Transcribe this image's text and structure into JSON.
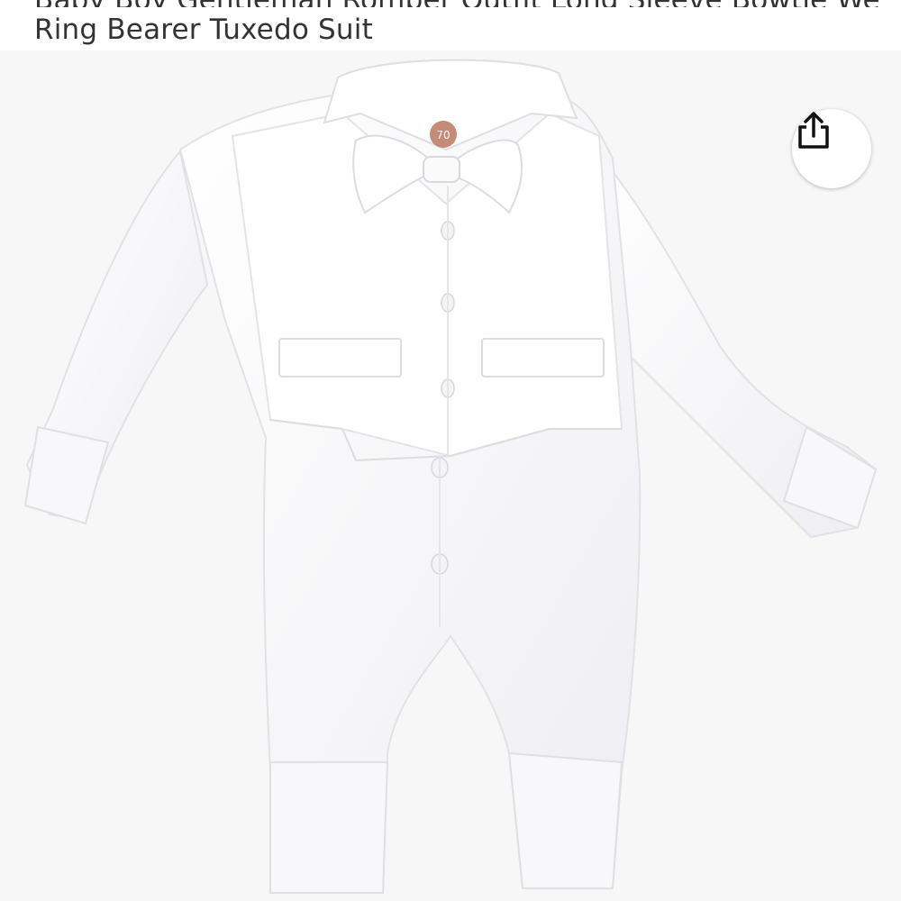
{
  "product": {
    "title_partial_line": "Baby Boy Gentleman Romper Outfit Long Sleeve Bowtie Wedding Party",
    "title_last_line": "Ring Bearer Tuxedo Suit",
    "size_tag": "70"
  },
  "toolbar": {
    "share_icon": "share-icon"
  },
  "colors": {
    "background": "#ffffff",
    "image_background": "#f7f7f7",
    "title_text": "#333333",
    "garment": "#fdfdfd",
    "garment_shadow": "#e6e6e9",
    "tag": "#c48b78"
  }
}
